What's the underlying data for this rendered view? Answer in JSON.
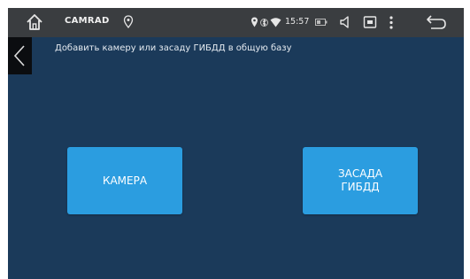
{
  "status_bar": {
    "app_name": "CAMRAD",
    "time": "15:57",
    "icons": [
      "home-icon",
      "gps-icon",
      "location-icon",
      "bluetooth-icon",
      "wifi-icon",
      "battery-icon",
      "volume-icon",
      "screen-icon",
      "menu-icon",
      "back-icon"
    ]
  },
  "header": {
    "title": "Добавить камеру или засаду ГИБДД в общую базу"
  },
  "buttons": {
    "camera_label": "КАМЕРА",
    "ambush_label": "ЗАСАДА\nГИБДД"
  },
  "colors": {
    "background": "#1b3a5a",
    "status_bar": "#3a3d40",
    "button": "#2b9de0",
    "back_tab": "#0b0d10"
  }
}
